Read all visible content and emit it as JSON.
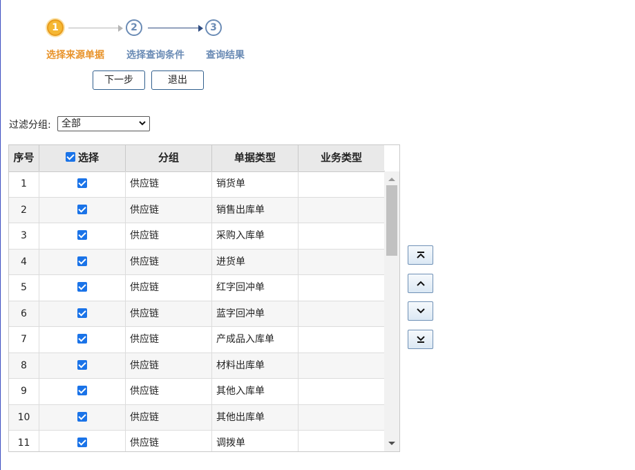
{
  "wizard": {
    "steps": [
      {
        "number": "1",
        "label": "选择来源单据"
      },
      {
        "number": "2",
        "label": "选择查询条件"
      },
      {
        "number": "3",
        "label": "查询结果"
      }
    ]
  },
  "buttons": {
    "next": "下一步",
    "exit": "退出"
  },
  "filter": {
    "label": "过滤分组:",
    "value": "全部"
  },
  "table": {
    "headers": [
      "序号",
      "选择",
      "分组",
      "单据类型",
      "业务类型"
    ],
    "rows": [
      {
        "no": "1",
        "checked": true,
        "group": "供应链",
        "doc_type": "销货单",
        "biz_type": ""
      },
      {
        "no": "2",
        "checked": true,
        "group": "供应链",
        "doc_type": "销售出库单",
        "biz_type": ""
      },
      {
        "no": "3",
        "checked": true,
        "group": "供应链",
        "doc_type": "采购入库单",
        "biz_type": ""
      },
      {
        "no": "4",
        "checked": true,
        "group": "供应链",
        "doc_type": "进货单",
        "biz_type": ""
      },
      {
        "no": "5",
        "checked": true,
        "group": "供应链",
        "doc_type": "红字回冲单",
        "biz_type": ""
      },
      {
        "no": "6",
        "checked": true,
        "group": "供应链",
        "doc_type": "蓝字回冲单",
        "biz_type": ""
      },
      {
        "no": "7",
        "checked": true,
        "group": "供应链",
        "doc_type": "产成品入库单",
        "biz_type": ""
      },
      {
        "no": "8",
        "checked": true,
        "group": "供应链",
        "doc_type": "材料出库单",
        "biz_type": ""
      },
      {
        "no": "9",
        "checked": true,
        "group": "供应链",
        "doc_type": "其他入库单",
        "biz_type": ""
      },
      {
        "no": "10",
        "checked": true,
        "group": "供应链",
        "doc_type": "其他出库单",
        "biz_type": ""
      },
      {
        "no": "11",
        "checked": true,
        "group": "供应链",
        "doc_type": "调拨单",
        "biz_type": ""
      }
    ]
  },
  "colors": {
    "active_step": "#e8932a",
    "inactive_step": "#6a8bb5",
    "checkbox": "#1a73e8"
  }
}
